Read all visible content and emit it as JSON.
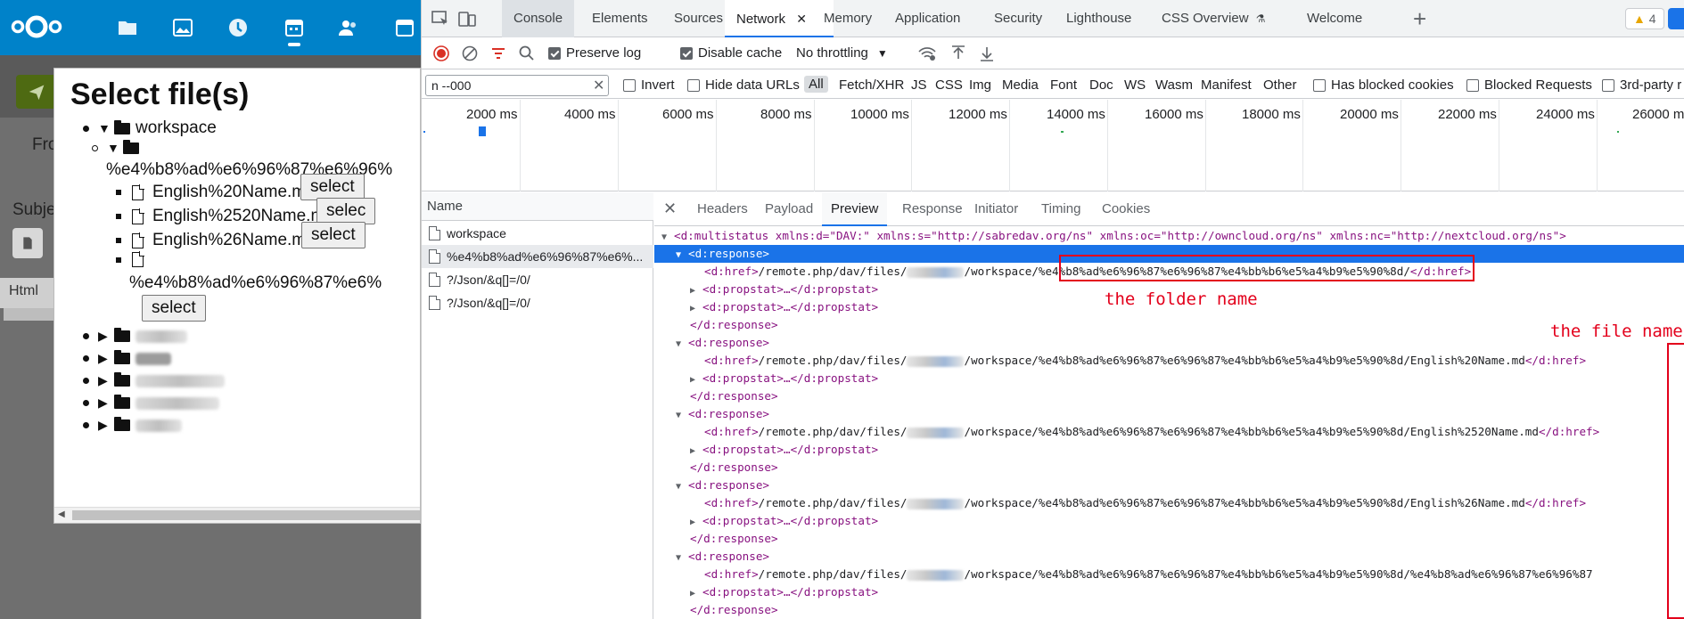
{
  "nextcloud": {
    "from_label": "Fro",
    "subject_label": "Subje",
    "html_tab": "Html",
    "apps": [
      "files-icon",
      "photos-icon",
      "activity-icon",
      "calendar-icon",
      "contacts-icon",
      "calendar-icon"
    ]
  },
  "dialog": {
    "title": "Select file(s)",
    "tree": {
      "root_folder": "workspace",
      "sub_folder": "%e4%b8%ad%e6%96%87%e6%96%",
      "files": [
        {
          "name": "English%20Name.md",
          "button": "select"
        },
        {
          "name": "English%2520Name.md",
          "button": "selec"
        },
        {
          "name": "English%26Name.md",
          "button": "select"
        },
        {
          "name": "%e4%b8%ad%e6%96%87%e6%",
          "button": "select"
        }
      ]
    }
  },
  "devtools": {
    "tabs": [
      "Console",
      "Elements",
      "Sources",
      "Network",
      "Memory",
      "Application",
      "Security",
      "Lighthouse",
      "CSS Overview",
      "Welcome"
    ],
    "active_tab": "Network",
    "issues_count": "4",
    "toolbar": {
      "preserve_log": "Preserve log",
      "disable_cache": "Disable cache",
      "throttling": "No throttling"
    },
    "filter": {
      "value": "n --000",
      "invert": "Invert",
      "hide_data_urls": "Hide data URLs",
      "types": [
        "All",
        "Fetch/XHR",
        "JS",
        "CSS",
        "Img",
        "Media",
        "Font",
        "Doc",
        "WS",
        "Wasm",
        "Manifest",
        "Other"
      ],
      "has_blocked_cookies": "Has blocked cookies",
      "blocked_requests": "Blocked Requests",
      "third_party": "3rd-party r"
    },
    "timeline_ticks": [
      "2000 ms",
      "4000 ms",
      "6000 ms",
      "8000 ms",
      "10000 ms",
      "12000 ms",
      "14000 ms",
      "16000 ms",
      "18000 ms",
      "20000 ms",
      "22000 ms",
      "24000 ms",
      "26000 ms"
    ],
    "requests": {
      "header": "Name",
      "rows": [
        "workspace",
        "%e4%b8%ad%e6%96%87%e6%...",
        "?/Json/&q[]=/0/",
        "?/Json/&q[]=/0/"
      ]
    },
    "detail_tabs": [
      "Headers",
      "Payload",
      "Preview",
      "Response",
      "Initiator",
      "Timing",
      "Cookies"
    ],
    "active_detail_tab": "Preview",
    "xml": {
      "multistatus": "<d:multistatus xmlns:d=\"DAV:\" xmlns:s=\"http://sabredav.org/ns\" xmlns:oc=\"http://owncloud.org/ns\" xmlns:nc=\"http://nextcloud.org/ns\">",
      "response_open": "<d:response>",
      "response_close": "</d:response>",
      "href_open": "<d:href>",
      "href_close": "</d:href>",
      "href_prefix": "/remote.php/dav/files/",
      "workspace": "/workspace",
      "folder_name": "/%e4%b8%ad%e6%96%87%e6%96%87%e4%bb%b6%e5%a4%b9%e5%90%8d/",
      "folder_path": "/workspace/%e4%b8%ad%e6%96%87%e6%96%87%e4%bb%b6%e5%a4%b9%e5%90%8d/",
      "propstat": "<d:propstat>…</d:propstat>",
      "files": [
        "English%20Name.md",
        "English%2520Name.md",
        "English%26Name.md",
        "%e4%b8%ad%e6%96%87%e6%96%87"
      ]
    },
    "annotations": {
      "folder_label": "the folder name",
      "file_label": "the file name"
    }
  },
  "colors": {
    "nextcloud_blue": "#0082c9",
    "devtools_accent": "#1a73e8",
    "annotation_red": "#e3001b",
    "xml_tag": "#881280"
  }
}
